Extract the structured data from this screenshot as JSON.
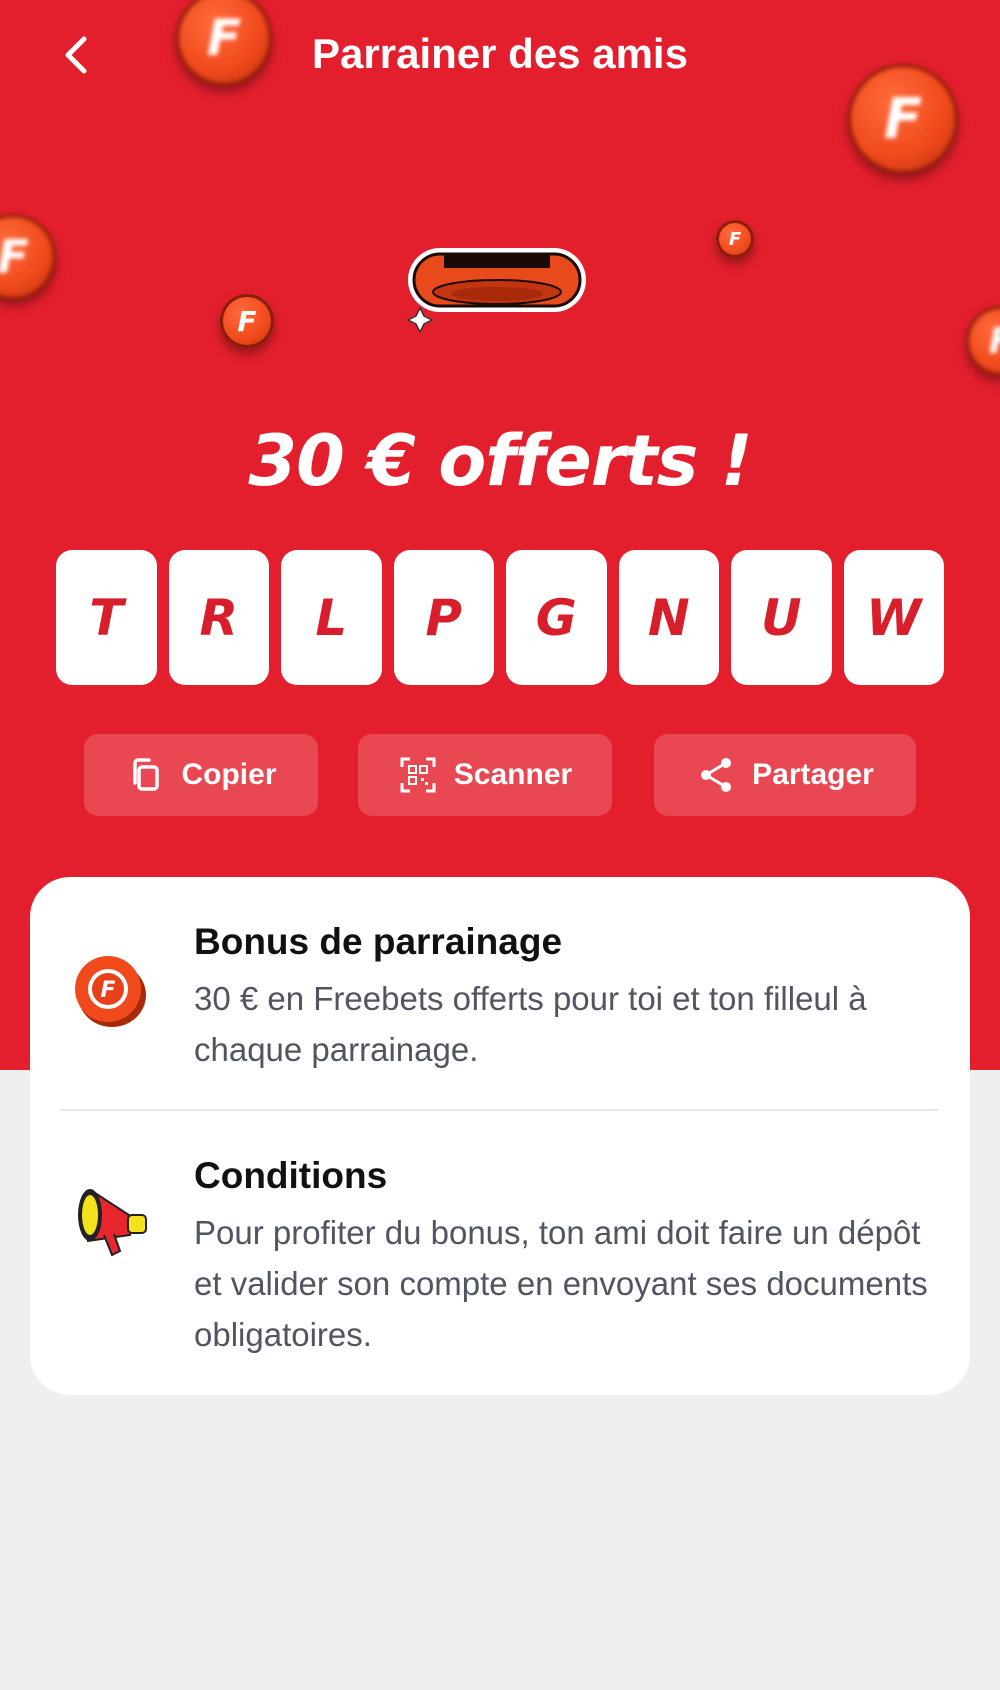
{
  "header": {
    "title": "Parrainer des amis"
  },
  "hero": {
    "headline": "30 € offerts !",
    "coin_letter": "F"
  },
  "code": {
    "letters": [
      "T",
      "R",
      "L",
      "P",
      "G",
      "N",
      "U",
      "W"
    ]
  },
  "actions": {
    "copy_label": "Copier",
    "scan_label": "Scanner",
    "share_label": "Partager"
  },
  "info": {
    "bonus_title": "Bonus de parrainage",
    "bonus_text": "30 € en Freebets offerts pour toi et ton filleul à chaque parrainage.",
    "conditions_title": "Conditions",
    "conditions_text": "Pour profiter du bonus, ton ami doit faire un dépôt et valider son compte en envoyant ses documents obligatoires."
  },
  "colors": {
    "brand_red": "#e41f2d",
    "coin_orange": "#f04a1c",
    "page_bg": "#eeeff1"
  }
}
